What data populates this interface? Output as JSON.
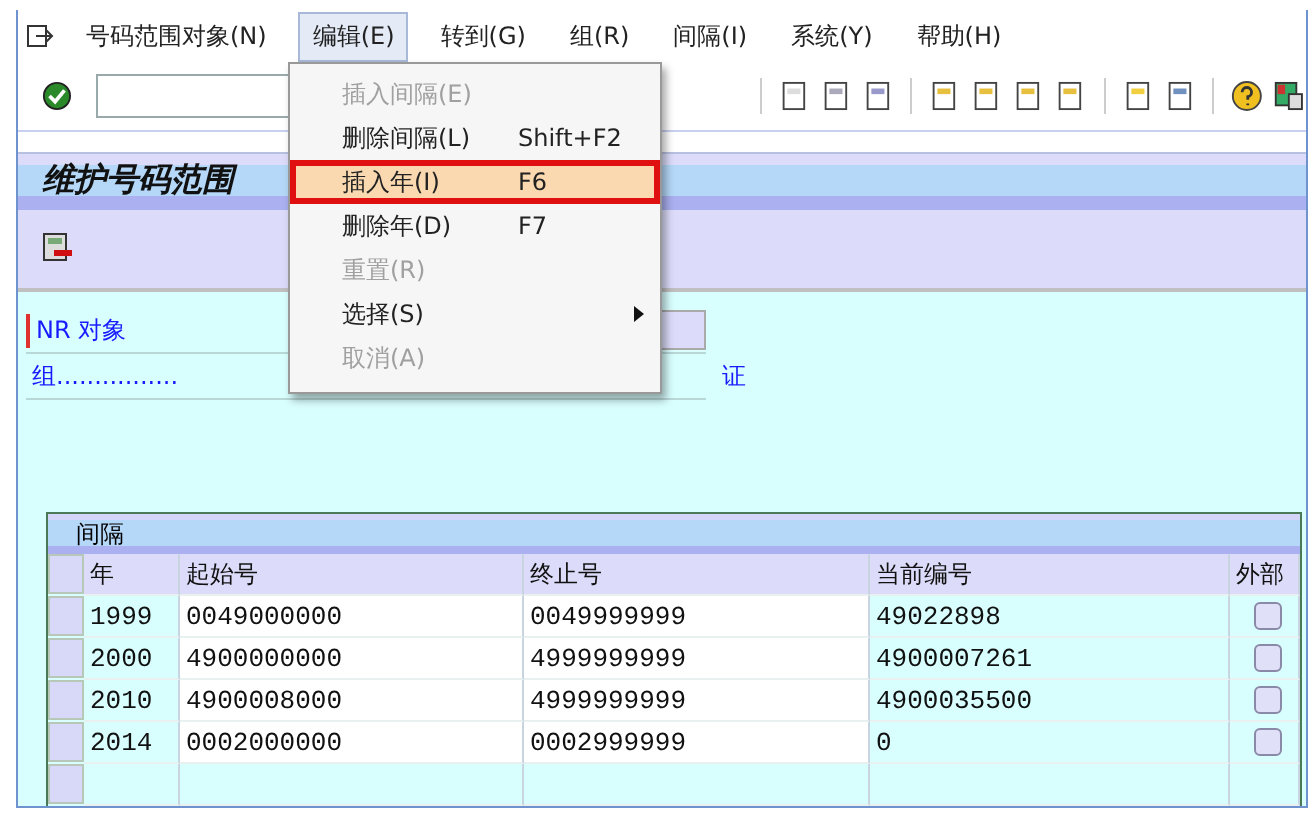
{
  "menubar": {
    "items": [
      {
        "label": "号码范围对象(N)",
        "selected": false
      },
      {
        "label": "编辑(E)",
        "selected": true
      },
      {
        "label": "转到(G)",
        "selected": false
      },
      {
        "label": "组(R)",
        "selected": false
      },
      {
        "label": "间隔(I)",
        "selected": false
      },
      {
        "label": "系统(Y)",
        "selected": false
      },
      {
        "label": "帮助(H)",
        "selected": false
      }
    ]
  },
  "title": "维护号码范围",
  "form": {
    "fields": [
      {
        "label": "NR 对象",
        "required": true
      },
      {
        "label": "组................",
        "required": false
      }
    ],
    "fragment": "证"
  },
  "menu": {
    "items": [
      {
        "label": "插入间隔(E)",
        "disabled": true,
        "selected": false
      },
      {
        "label": "删除间隔(L)",
        "shortcut": "Shift+F2",
        "disabled": false,
        "selected": false
      },
      {
        "label": "插入年(I)",
        "shortcut": "F6",
        "disabled": false,
        "selected": true
      },
      {
        "label": "删除年(D)",
        "shortcut": "F7",
        "disabled": false,
        "selected": false
      },
      {
        "label": "重置(R)",
        "disabled": true,
        "selected": false
      },
      {
        "label": "选择(S)",
        "disabled": false,
        "selected": false,
        "submenu": true
      },
      {
        "label": "取消(A)",
        "disabled": true,
        "selected": false
      }
    ]
  },
  "table": {
    "title": "间隔",
    "columns": [
      "年",
      "起始号",
      "终止号",
      "当前编号",
      "外部"
    ],
    "rows": [
      {
        "cells": [
          "1999",
          "0049000000",
          "0049999999",
          "49022898"
        ],
        "external": false
      },
      {
        "cells": [
          "2000",
          "4900000000",
          "4999999999",
          "4900007261"
        ],
        "external": false
      },
      {
        "cells": [
          "2010",
          "4900008000",
          "4999999999",
          "4900035500"
        ],
        "external": false
      },
      {
        "cells": [
          "2014",
          "0002000000",
          "0002999999",
          "0"
        ],
        "external": false
      }
    ]
  }
}
